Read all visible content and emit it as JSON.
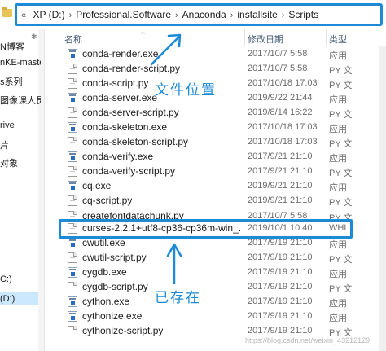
{
  "address_bar": {
    "lead": "«",
    "crumbs": [
      "XP (D:)",
      "Professional.Software",
      "Anaconda",
      "installsite",
      "Scripts"
    ],
    "separator": "›",
    "highlight_color": "#1c8ad6"
  },
  "nav": {
    "items": [
      {
        "label": "N博客",
        "selected": false
      },
      {
        "label": "nKE-maste",
        "selected": false
      },
      {
        "label": "s系列",
        "selected": false
      },
      {
        "label": "图像课人员",
        "selected": false
      },
      {
        "label": "rive",
        "selected": false
      },
      {
        "label": "片",
        "selected": false
      },
      {
        "label": "对象",
        "selected": false
      },
      {
        "label": "C:)",
        "selected": false
      },
      {
        "label": "(D:)",
        "selected": true
      }
    ]
  },
  "columns": {
    "name": "名称",
    "date": "修改日期",
    "type": "类型"
  },
  "files": [
    {
      "name": "conda-render.exe",
      "date": "2017/10/7 5:58",
      "type": "应用",
      "icon": "exe"
    },
    {
      "name": "conda-render-script.py",
      "date": "2017/10/7 5:58",
      "type": "PY 文",
      "icon": "py"
    },
    {
      "name": "conda-script.py",
      "date": "2017/10/18 17:03",
      "type": "PY 文",
      "icon": "py"
    },
    {
      "name": "conda-server.exe",
      "date": "2019/9/22 21:44",
      "type": "应用",
      "icon": "exe"
    },
    {
      "name": "conda-server-script.py",
      "date": "2019/8/14 16:22",
      "type": "PY 文",
      "icon": "py"
    },
    {
      "name": "conda-skeleton.exe",
      "date": "2017/10/18 17:03",
      "type": "应用",
      "icon": "exe"
    },
    {
      "name": "conda-skeleton-script.py",
      "date": "2017/10/18 17:03",
      "type": "PY 文",
      "icon": "py"
    },
    {
      "name": "conda-verify.exe",
      "date": "2017/9/21 21:10",
      "type": "应用",
      "icon": "exe"
    },
    {
      "name": "conda-verify-script.py",
      "date": "2017/9/21 21:10",
      "type": "PY 文",
      "icon": "py"
    },
    {
      "name": "cq.exe",
      "date": "2019/9/21 21:10",
      "type": "应用",
      "icon": "exe"
    },
    {
      "name": "cq-script.py",
      "date": "2019/9/21 21:10",
      "type": "PY 文",
      "icon": "py"
    },
    {
      "name": "createfontdatachunk.py",
      "date": "2017/10/7 5:58",
      "type": "PY 文",
      "icon": "py"
    },
    {
      "name": "curses-2.2.1+utf8-cp36-cp36m-win_...",
      "date": "2019/10/1 10:40",
      "type": "WHL",
      "icon": "blank",
      "highlighted": true
    },
    {
      "name": "cwutil.exe",
      "date": "2017/9/19 21:10",
      "type": "应用",
      "icon": "exe"
    },
    {
      "name": "cwutil-script.py",
      "date": "2017/9/19 21:10",
      "type": "PY 文",
      "icon": "py"
    },
    {
      "name": "cygdb.exe",
      "date": "2017/9/19 21:10",
      "type": "应用",
      "icon": "exe"
    },
    {
      "name": "cygdb-script.py",
      "date": "2017/9/19 21:10",
      "type": "PY 文",
      "icon": "py"
    },
    {
      "name": "cython.exe",
      "date": "2017/9/19 21:10",
      "type": "应用",
      "icon": "exe"
    },
    {
      "name": "cythonize.exe",
      "date": "2017/9/19 21:10",
      "type": "应用",
      "icon": "exe"
    },
    {
      "name": "cythonize-script.py",
      "date": "2017/9/19 21:10",
      "type": "PY 文",
      "icon": "py"
    }
  ],
  "annotations": {
    "file_location": "文件位置",
    "already_exists": "已存在"
  },
  "watermark": "https://blog.csdn.net/weixin_43212129"
}
